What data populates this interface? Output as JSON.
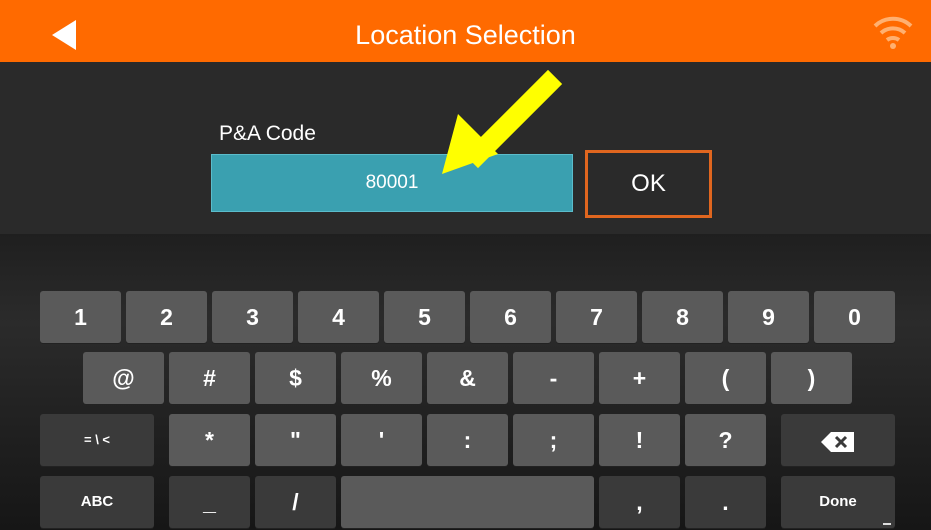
{
  "header": {
    "title": "Location Selection",
    "back_icon": "back-arrow-icon",
    "status_icon": "wifi-icon"
  },
  "form": {
    "label": "P&A Code",
    "value": "80001",
    "ok_label": "OK"
  },
  "keyboard": {
    "row1": [
      "1",
      "2",
      "3",
      "4",
      "5",
      "6",
      "7",
      "8",
      "9",
      "0"
    ],
    "row2": [
      "@",
      "#",
      "$",
      "%",
      "&",
      "-",
      "+",
      "(",
      ")"
    ],
    "row3": [
      "= \\ <",
      "*",
      "\"",
      "'",
      ":",
      ";",
      "!",
      "?"
    ],
    "row4": [
      "ABC",
      "_",
      "/",
      "",
      ",",
      ".",
      "Done"
    ],
    "backspace_icon": "backspace-icon"
  },
  "colors": {
    "header": "#ff6a00",
    "input": "#3aa0b0",
    "ok_border": "#e0661f",
    "annotation_arrow": "#ffff00"
  }
}
